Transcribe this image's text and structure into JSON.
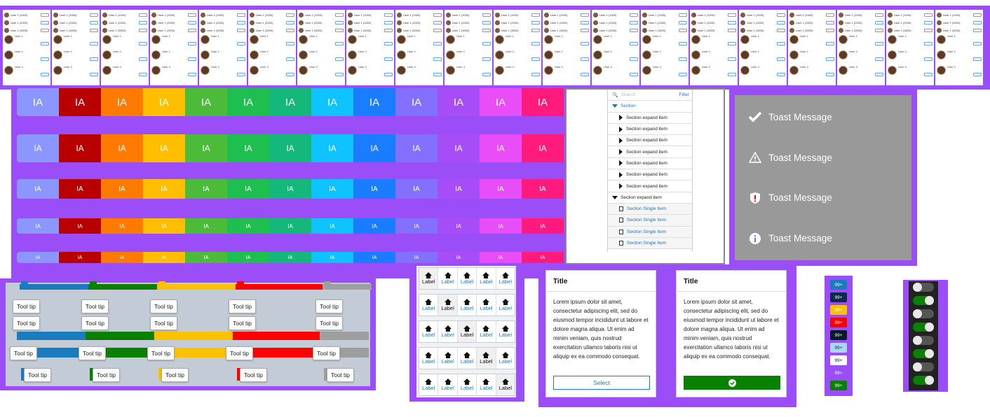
{
  "top_strip": {
    "columns": 20,
    "row_labels": [
      "User 1 (1000)",
      "User 1 (2000)",
      "User 1 (3000)"
    ],
    "card_labels": [
      "User 1",
      "User 2",
      "User 3"
    ]
  },
  "avatars": {
    "initials": "IA",
    "colors": [
      "#8c96ff",
      "#b80000",
      "#ff7a00",
      "#ffbf00",
      "#4dbb3a",
      "#1fbf4f",
      "#14b87a",
      "#0ec3ff",
      "#1a7cff",
      "#8470ff",
      "#a64df7",
      "#e84df7",
      "#ff1a7d"
    ]
  },
  "tree": {
    "search_placeholder": "Search",
    "filter_label": "Filter",
    "section_label": "Section",
    "expand_item_label": "Section expand item",
    "single_item_label": "Section Single Item"
  },
  "toasts": [
    {
      "label": "Toast Message",
      "color": "#0a8000",
      "icon": "check-icon"
    },
    {
      "label": "Toast Message",
      "color": "#ffaa00",
      "icon": "warning-icon"
    },
    {
      "label": "Toast Message",
      "color": "#ff0000",
      "icon": "shield-alert-icon"
    },
    {
      "label": "Toast Message",
      "color": "#9b4df7",
      "icon": "info-icon"
    }
  ],
  "tooltips": {
    "label": "Tool tip",
    "colors": [
      "#1a7cbf",
      "#0a8000",
      "#ffc000",
      "#ff0000",
      "#9e9e9e"
    ]
  },
  "segments": {
    "label": "Label"
  },
  "cards": [
    {
      "title": "Title",
      "body": "Lorem ipsum dolor sit amet, consectetur adipiscing elit, sed do eiusmod tempor incididunt ut labore et dolore magna aliqua. Ut enim ad minim veniam, quis nostrud exercitation ullamco laboris nisi ut aliquip ex ea commodo consequat.",
      "button": "Select"
    },
    {
      "title": "Title",
      "body": "Lorem ipsum dolor sit amet, consectetur adipiscing elit, sed do eiusmod tempor incididunt ut labore et dolore magna aliqua. Ut enim ad minim veniam, quis nostrud exercitation ullamco laboris nisi ut aliquip ex ea commodo consequat.",
      "button": ""
    }
  ],
  "badges": {
    "label": "99+",
    "colors": [
      "#1a7cbf",
      "#0d2a4a",
      "#ffc000",
      "#ff0000",
      "#061a2a",
      "#a8d8ff",
      "#ffffff",
      "#9b4df7",
      "#0a8000"
    ]
  },
  "toggles": {
    "states": [
      false,
      true,
      false,
      true,
      false,
      true,
      false,
      true
    ]
  }
}
